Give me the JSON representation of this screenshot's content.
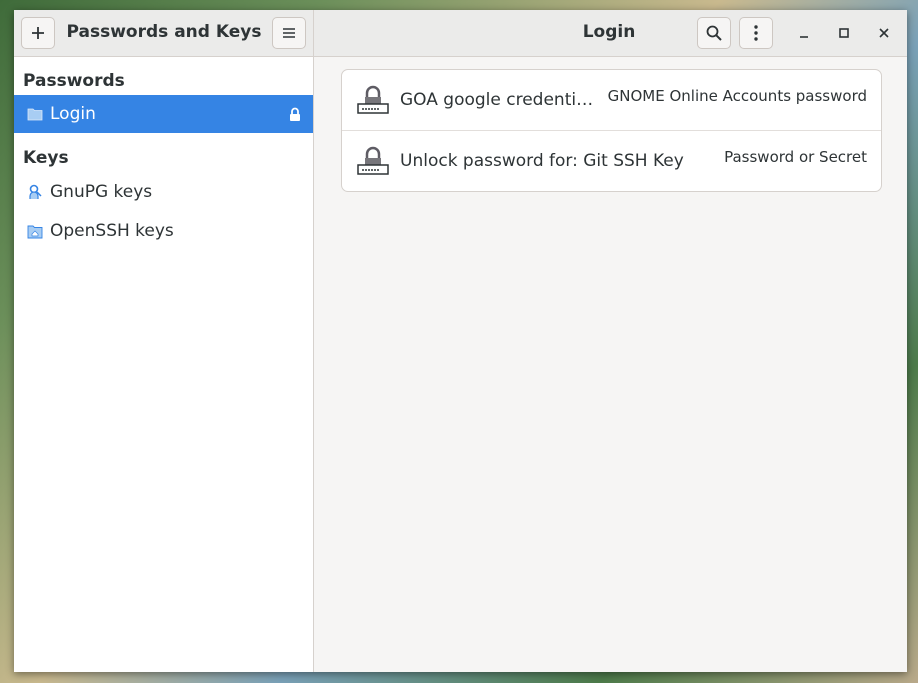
{
  "app": {
    "title": "Passwords and Keys"
  },
  "sidebar": {
    "sections": [
      {
        "title": "Passwords",
        "items": [
          {
            "label": "Login",
            "icon": "folder-icon",
            "selected": true,
            "badge": "lock-icon"
          }
        ]
      },
      {
        "title": "Keys",
        "items": [
          {
            "label": "GnuPG keys",
            "icon": "gnupg-key-icon",
            "selected": false
          },
          {
            "label": "OpenSSH keys",
            "icon": "openssh-folder-icon",
            "selected": false
          }
        ]
      }
    ]
  },
  "main": {
    "title": "Login",
    "items": [
      {
        "name": "GOA google credential…",
        "type": "GNOME Online Accounts password",
        "icon": "password-lock-icon"
      },
      {
        "name": "Unlock password for: Git SSH Key",
        "type": "Password or Secret",
        "icon": "password-lock-icon"
      }
    ]
  },
  "colors": {
    "accent": "#3584e4",
    "header_bg": "#ebebea",
    "window_bg": "#f6f5f4"
  }
}
